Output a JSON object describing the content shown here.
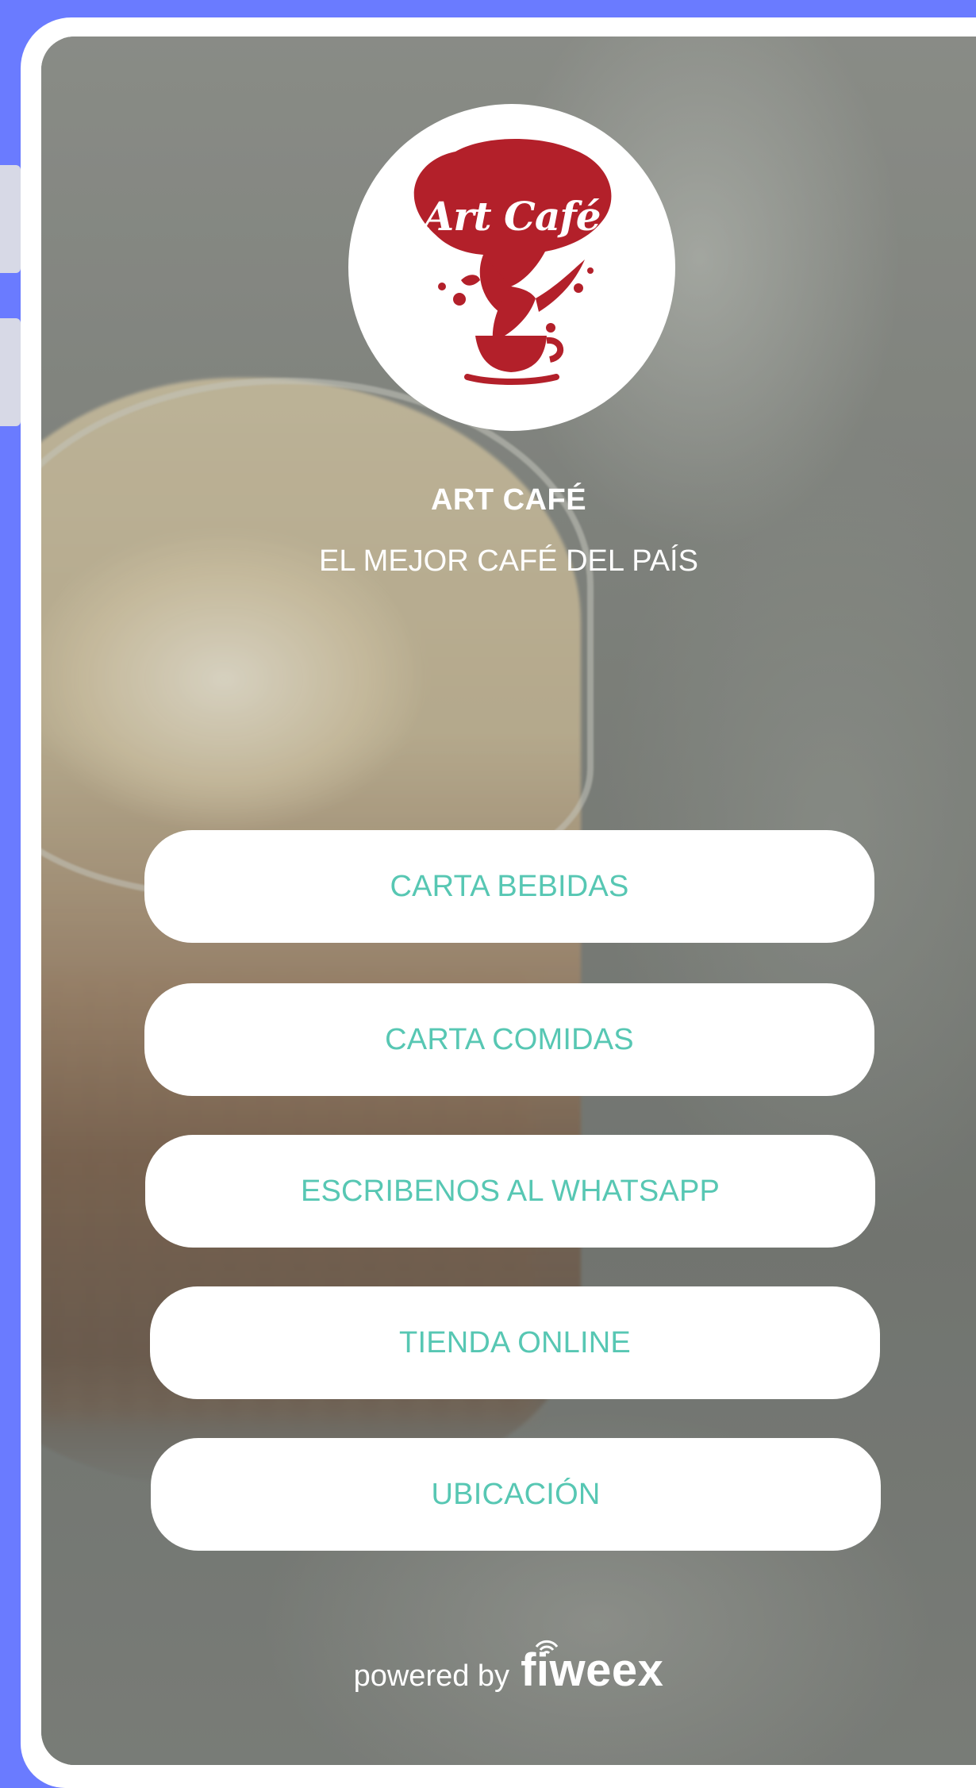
{
  "brand_color": "#b3202a",
  "accent_color": "#57c7b3",
  "logo": {
    "text": "Art Café"
  },
  "business": {
    "name": "ART CAFÉ",
    "tagline": "EL MEJOR CAFÉ DEL PAÍS"
  },
  "menu": [
    {
      "label": "CARTA BEBIDAS"
    },
    {
      "label": "CARTA COMIDAS"
    },
    {
      "label": "ESCRIBENOS AL WHATSAPP"
    },
    {
      "label": "TIENDA ONLINE"
    },
    {
      "label": "UBICACIÓN"
    }
  ],
  "footer": {
    "powered_by": "powered by",
    "brand": "fiweex"
  },
  "icons": {
    "logo_icon": "coffee-cup-splash-icon",
    "brand_mark": "wifi-signal-icon"
  }
}
